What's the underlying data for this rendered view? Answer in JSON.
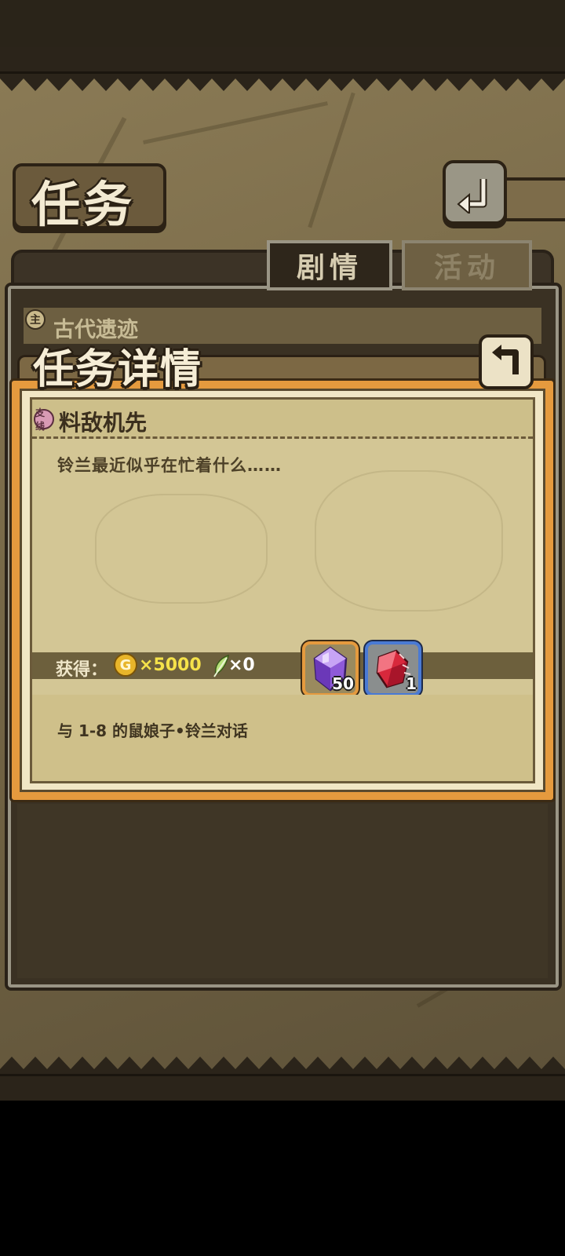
{
  "header": {
    "title": "任务",
    "back_icon": "return-arrow-icon"
  },
  "tabs": [
    {
      "label": "剧情",
      "active": true
    },
    {
      "label": "活动",
      "active": false
    }
  ],
  "quest_list": {
    "main_badge": "主",
    "current_chapter": "古代遗迹"
  },
  "detail": {
    "title": "任务详情",
    "back_icon": "return-arrow-icon",
    "quest_type_badge": "支线",
    "quest_name": "料敌机先",
    "description": "铃兰最近似乎在忙着什么……",
    "rewards": {
      "label": "获得：",
      "gold_icon_glyph": "G",
      "gold": "×5000",
      "feather": "×0",
      "items": [
        {
          "icon": "purple-gem-icon",
          "count": "50",
          "border_color": "#e59a3e"
        },
        {
          "icon": "red-crystal-shard-icon",
          "count": "1",
          "border_color": "#4a7ad4"
        }
      ]
    },
    "objective": "与 1-8 的鼠娘子•铃兰对话"
  },
  "colors": {
    "frame_orange": "#e59a3e",
    "paper": "#d3c695",
    "gold_text": "#f5e24a",
    "rare_blue": "#4a7ad4"
  }
}
